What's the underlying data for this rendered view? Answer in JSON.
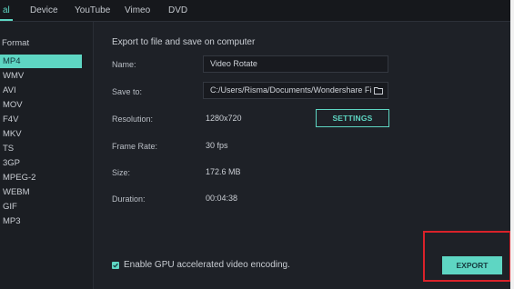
{
  "tabs": [
    {
      "label": "al",
      "active": true
    },
    {
      "label": "Device",
      "active": false
    },
    {
      "label": "YouTube",
      "active": false
    },
    {
      "label": "Vimeo",
      "active": false
    },
    {
      "label": "DVD",
      "active": false
    }
  ],
  "format_panel": {
    "heading": "Format",
    "items": [
      "MP4",
      "WMV",
      "AVI",
      "MOV",
      "F4V",
      "MKV",
      "TS",
      "3GP",
      "MPEG-2",
      "WEBM",
      "GIF",
      "MP3"
    ],
    "selected": "MP4"
  },
  "main": {
    "section_title": "Export to file and save on computer",
    "name_label": "Name:",
    "name_value": "Video Rotate",
    "save_to_label": "Save to:",
    "save_to_value": "C:/Users/Risma/Documents/Wondershare Fi",
    "resolution_label": "Resolution:",
    "resolution_value": "1280x720",
    "settings_button": "SETTINGS",
    "frame_rate_label": "Frame Rate:",
    "frame_rate_value": "30 fps",
    "size_label": "Size:",
    "size_value": "172.6 MB",
    "duration_label": "Duration:",
    "duration_value": "00:04:38",
    "gpu_label": "Enable GPU accelerated video encoding.",
    "gpu_checked": true,
    "export_button": "EXPORT"
  },
  "colors": {
    "accent": "#5ed6c3",
    "highlight_box": "#d9222a",
    "background": "#1e2127"
  },
  "icons": {
    "folder": "folder-icon",
    "checkbox": "checkmark-icon"
  }
}
